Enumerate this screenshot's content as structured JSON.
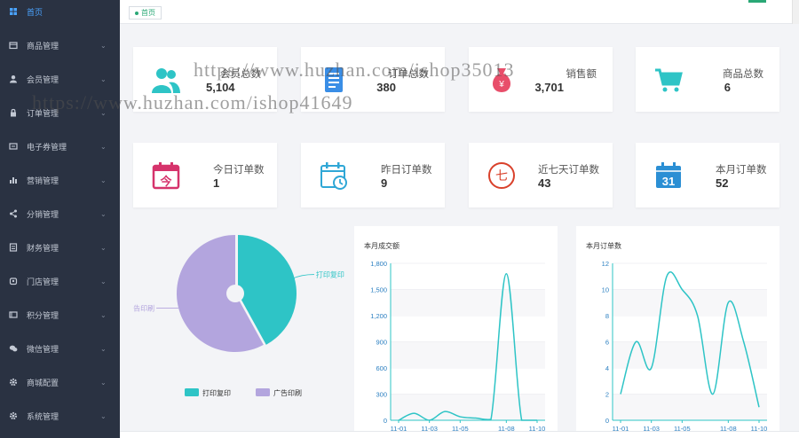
{
  "sidebar": {
    "items": [
      {
        "label": "首页",
        "icon": "dashboard-icon",
        "active": true
      },
      {
        "label": "商品管理",
        "icon": "box-icon"
      },
      {
        "label": "会员管理",
        "icon": "user-icon"
      },
      {
        "label": "订单管理",
        "icon": "lock-icon"
      },
      {
        "label": "电子券管理",
        "icon": "coupon-icon"
      },
      {
        "label": "营销管理",
        "icon": "bar-chart-icon"
      },
      {
        "label": "分销管理",
        "icon": "share-icon"
      },
      {
        "label": "财务管理",
        "icon": "ledger-icon"
      },
      {
        "label": "门店管理",
        "icon": "store-icon"
      },
      {
        "label": "积分管理",
        "icon": "card-icon"
      },
      {
        "label": "微信管理",
        "icon": "wechat-icon"
      },
      {
        "label": "商城配置",
        "icon": "gear-icon"
      },
      {
        "label": "系统管理",
        "icon": "gear-icon"
      }
    ]
  },
  "topbar": {
    "tab_home": "首页"
  },
  "stats_row1": [
    {
      "label": "会员总数",
      "value": "5,104",
      "icon": "users-icon",
      "color": "#2ec4c6"
    },
    {
      "label": "订单总数",
      "value": "380",
      "icon": "document-icon",
      "color": "#3a8ee6"
    },
    {
      "label": "销售额",
      "value": "3,701",
      "icon": "money-bag-icon",
      "color": "#e84e6a"
    },
    {
      "label": "商品总数",
      "value": "6",
      "icon": "cart-icon",
      "color": "#2ec4c6"
    }
  ],
  "stats_row2": [
    {
      "label": "今日订单数",
      "value": "1",
      "icon": "calendar-today-icon",
      "color": "#d6336c"
    },
    {
      "label": "昨日订单数",
      "value": "9",
      "icon": "calendar-clock-icon",
      "color": "#2fa7d6"
    },
    {
      "label": "近七天订单数",
      "value": "43",
      "icon": "seven-days-icon",
      "color": "#d9412b"
    },
    {
      "label": "本月订单数",
      "value": "52",
      "icon": "calendar-31-icon",
      "color": "#2b8fd4",
      "icon_text": "31"
    }
  ],
  "icon_glyphs": {
    "today": "今",
    "seven": "七"
  },
  "watermark": {
    "line1": "https://www.huzhan.com/ishop35013",
    "line2": "https://www.huzhan.com/ishop41649"
  },
  "chart_data": [
    {
      "type": "pie",
      "title": "",
      "slices": [
        {
          "name": "打印复印",
          "value": 42,
          "color": "#2ec4c6"
        },
        {
          "name": "广告印刷",
          "value": 58,
          "color": "#b3a5de"
        }
      ],
      "legend_placement": "bottom"
    },
    {
      "type": "line",
      "title": "本月成交额",
      "x": [
        "11-01",
        "11-02",
        "11-03",
        "11-04",
        "11-05",
        "11-06",
        "11-07",
        "11-08",
        "11-09",
        "11-10"
      ],
      "series": [
        {
          "values": [
            0,
            80,
            0,
            100,
            40,
            25,
            10,
            1680,
            0,
            0
          ],
          "color": "#2ec4c6"
        }
      ],
      "x_ticks": [
        "11-01",
        "11-03",
        "11-05",
        "11-08",
        "11-10"
      ],
      "y_ticks": [
        "0",
        "300",
        "600",
        "900",
        "1,200",
        "1,500",
        "1,800"
      ],
      "ylim": [
        0,
        1800
      ],
      "grid": true
    },
    {
      "type": "line",
      "title": "本月订单数",
      "x": [
        "11-01",
        "11-02",
        "11-03",
        "11-04",
        "11-05",
        "11-06",
        "11-07",
        "11-08",
        "11-09",
        "11-10"
      ],
      "series": [
        {
          "values": [
            2,
            6,
            4,
            11,
            10,
            8,
            2,
            9,
            6,
            1
          ],
          "color": "#2ec4c6"
        }
      ],
      "x_ticks": [
        "11-01",
        "11-03",
        "11-05",
        "11-08",
        "11-10"
      ],
      "y_ticks": [
        "0",
        "2",
        "4",
        "6",
        "8",
        "10",
        "12"
      ],
      "ylim": [
        0,
        12
      ],
      "grid": true
    }
  ]
}
